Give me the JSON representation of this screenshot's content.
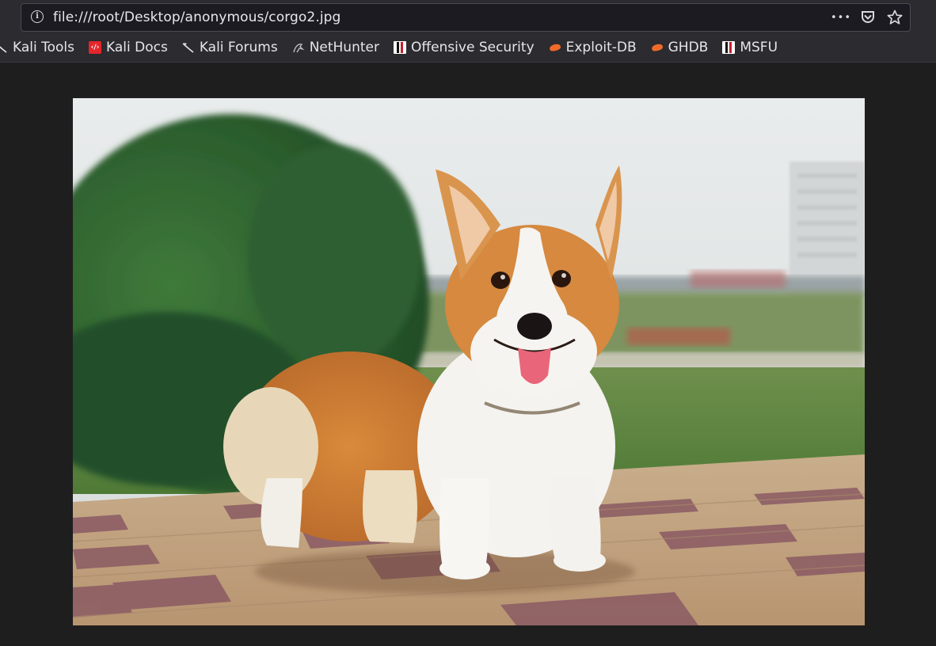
{
  "address_bar": {
    "url": "file:///root/Desktop/anonymous/corgo2.jpg",
    "more_label": "•••"
  },
  "bookmarks": [
    {
      "label": "Kali Tools",
      "icon": "kali-dragon-icon"
    },
    {
      "label": "Kali Docs",
      "icon": "kali-docs-icon"
    },
    {
      "label": "Kali Forums",
      "icon": "kali-dragon-icon"
    },
    {
      "label": "NetHunter",
      "icon": "nethunter-icon"
    },
    {
      "label": "Offensive Security",
      "icon": "offensive-security-icon"
    },
    {
      "label": "Exploit-DB",
      "icon": "exploit-db-icon"
    },
    {
      "label": "GHDB",
      "icon": "exploit-db-icon"
    },
    {
      "label": "MSFU",
      "icon": "offensive-security-icon"
    }
  ],
  "colors": {
    "toolbar": "#2b2b30",
    "viewer_background": "#1e1e1e"
  }
}
